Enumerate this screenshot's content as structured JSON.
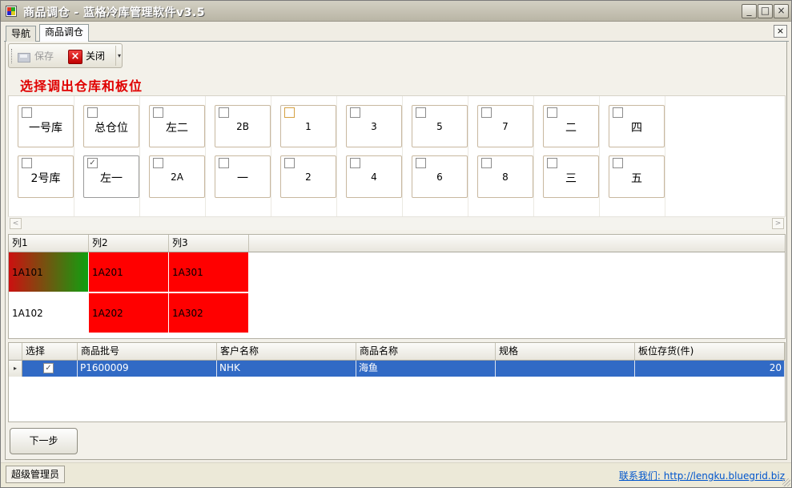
{
  "window": {
    "title": "商品调仓 - 蓝格冷库管理软件v3.5",
    "controls": {
      "minimize": "_",
      "maximize": "□",
      "close": "×"
    }
  },
  "tabs": [
    {
      "label": "导航",
      "active": false
    },
    {
      "label": "商品调仓",
      "active": true
    }
  ],
  "tab_close": "×",
  "toolbar": {
    "save_label": "保存",
    "close_label": "关闭",
    "close_glyph": "×",
    "dropdown_glyph": "▾"
  },
  "section_title": "选择调出仓库和板位",
  "locations": [
    {
      "label": "一号库",
      "checked": false
    },
    {
      "label": "2号库",
      "checked": false
    },
    {
      "label": "总仓位",
      "checked": false
    },
    {
      "label": "左一",
      "checked": true
    },
    {
      "label": "左二",
      "checked": false
    },
    {
      "label": "2A",
      "checked": false
    },
    {
      "label": "2B",
      "checked": false
    },
    {
      "label": "一",
      "checked": false
    },
    {
      "label": "1",
      "checked": false
    },
    {
      "label": "2",
      "checked": false
    },
    {
      "label": "3",
      "checked": false
    },
    {
      "label": "4",
      "checked": false
    },
    {
      "label": "5",
      "checked": false
    },
    {
      "label": "6",
      "checked": false
    },
    {
      "label": "7",
      "checked": false
    },
    {
      "label": "8",
      "checked": false
    },
    {
      "label": "二",
      "checked": false
    },
    {
      "label": "三",
      "checked": false
    },
    {
      "label": "四",
      "checked": false
    },
    {
      "label": "五",
      "checked": false
    }
  ],
  "check_glyph": "✓",
  "scroll": {
    "left": "<",
    "right": ">"
  },
  "rack": {
    "columns": [
      "列1",
      "列2",
      "列3"
    ],
    "rows": [
      [
        {
          "code": "1A101",
          "status": "partial"
        },
        {
          "code": "1A201",
          "status": "full"
        },
        {
          "code": "1A301",
          "status": "full"
        }
      ],
      [
        {
          "code": "1A102",
          "status": "empty"
        },
        {
          "code": "1A202",
          "status": "full"
        },
        {
          "code": "1A302",
          "status": "full"
        }
      ]
    ],
    "colors": {
      "full": "#ff0000",
      "partial_from": "#cc1010",
      "partial_to": "#10a010",
      "empty": "#ffffff"
    }
  },
  "stock": {
    "columns": [
      "选择",
      "商品批号",
      "客户名称",
      "商品名称",
      "规格",
      "板位存货(件)"
    ],
    "row_indicator": "▸",
    "rows": [
      {
        "selected": true,
        "batch": "P1600009",
        "customer": "NHK",
        "product": "海鱼",
        "spec": "",
        "qty": "20"
      }
    ],
    "selection_color": "#316ac5"
  },
  "next_button": "下一步",
  "status": {
    "user": "超级管理员",
    "contact": "联系我们: http://lengku.bluegrid.biz"
  }
}
